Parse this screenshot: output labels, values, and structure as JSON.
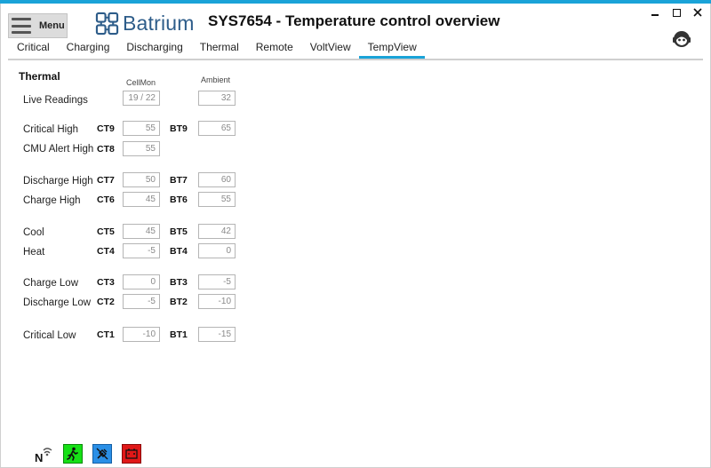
{
  "header": {
    "menu_label": "Menu",
    "logo_text": "Batrium",
    "title": "SYS7654 - Temperature control overview",
    "window_controls": {
      "minimize": "_",
      "maximize": "□",
      "close": "×"
    }
  },
  "tabs": [
    {
      "label": "Critical"
    },
    {
      "label": "Charging"
    },
    {
      "label": "Discharging"
    },
    {
      "label": "Thermal"
    },
    {
      "label": "Remote"
    },
    {
      "label": "VoltView"
    },
    {
      "label": "TempView",
      "active": true
    }
  ],
  "thermal": {
    "section_title": "Thermal",
    "col_cellmon": "CellMon",
    "col_ambient": "Ambient",
    "live": {
      "label": "Live Readings",
      "cellmon": "19 / 22",
      "ambient": "32"
    },
    "rows": [
      {
        "label": "Critical High",
        "ct": "CT9",
        "ct_val": "55",
        "bt": "BT9",
        "bt_val": "65"
      },
      {
        "label": "CMU Alert High",
        "ct": "CT8",
        "ct_val": "55"
      },
      {
        "label": "Discharge High",
        "ct": "CT7",
        "ct_val": "50",
        "bt": "BT7",
        "bt_val": "60"
      },
      {
        "label": "Charge High",
        "ct": "CT6",
        "ct_val": "45",
        "bt": "BT6",
        "bt_val": "55"
      },
      {
        "label": "Cool",
        "ct": "CT5",
        "ct_val": "45",
        "bt": "BT5",
        "bt_val": "42"
      },
      {
        "label": "Heat",
        "ct": "CT4",
        "ct_val": "-5",
        "bt": "BT4",
        "bt_val": "0"
      },
      {
        "label": "Charge Low",
        "ct": "CT3",
        "ct_val": "0",
        "bt": "BT3",
        "bt_val": "-5"
      },
      {
        "label": "Discharge Low",
        "ct": "CT2",
        "ct_val": "-5",
        "bt": "BT2",
        "bt_val": "-10"
      },
      {
        "label": "Critical Low",
        "ct": "CT1",
        "ct_val": "-10",
        "bt": "BT1",
        "bt_val": "-15"
      }
    ]
  },
  "status_icons": [
    {
      "name": "network-signal-icon"
    },
    {
      "name": "running-person-icon",
      "color": "#16e016"
    },
    {
      "name": "plug-disconnected-icon",
      "color": "#2a8fe6"
    },
    {
      "name": "battery-alert-icon",
      "color": "#e01818"
    }
  ],
  "colors": {
    "accent": "#1aa3d8",
    "logo": "#2e5d8a"
  }
}
